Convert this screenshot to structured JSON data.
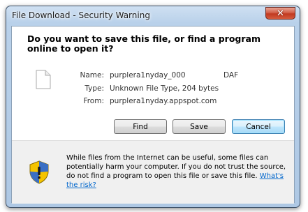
{
  "window": {
    "title": "File Download - Security Warning",
    "close_glyph": "✕"
  },
  "dialog": {
    "question": "Do you want to save this file, or find a program online to open it?",
    "file_icon": "document-icon",
    "fields": [
      {
        "label": "Name:",
        "value": "purplera1nyday_000",
        "extra": "DAF"
      },
      {
        "label": "Type:",
        "value": "Unknown File Type, 204 bytes"
      },
      {
        "label": "From:",
        "value": "purplera1nyday.appspot.com"
      }
    ],
    "buttons": {
      "find": "Find",
      "save": "Save",
      "cancel": "Cancel"
    }
  },
  "warning": {
    "icon": "security-shield-icon",
    "text": "While files from the Internet can be useful, some files can potentially harm your computer. If you do not trust the source, do not find a program to open this file or save this file.",
    "link": "What's the risk?"
  },
  "colors": {
    "link": "#0066cc",
    "shield_yellow": "#f5c400",
    "shield_blue": "#3a6fc4"
  }
}
